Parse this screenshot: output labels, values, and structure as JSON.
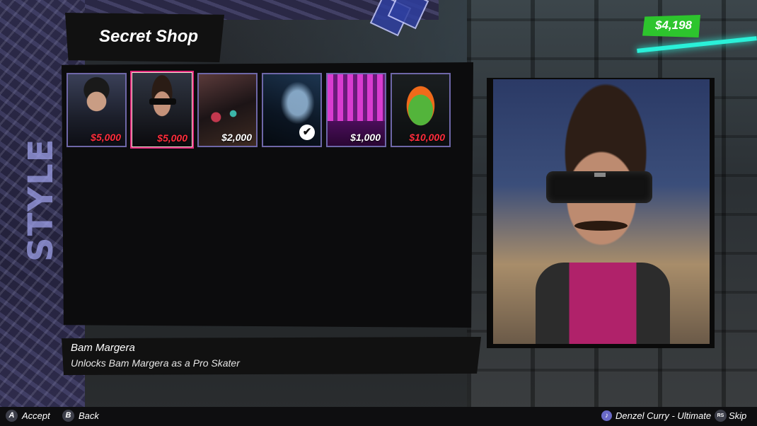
{
  "shop": {
    "title": "Secret Shop"
  },
  "wallet": {
    "balance": "$4,198",
    "color": "#2dc52d"
  },
  "items": [
    {
      "name": "pro-skater-helmet",
      "price": "$5,000",
      "price_color": "red",
      "owned": false
    },
    {
      "name": "pro-skater-bam-margera",
      "price": "$5,000",
      "price_color": "red",
      "owned": false,
      "selected": true
    },
    {
      "name": "skatepark-level",
      "price": "$2,000",
      "price_color": "white",
      "owned": false
    },
    {
      "name": "board-item",
      "price": "",
      "price_color": "white",
      "owned": true
    },
    {
      "name": "neon-level",
      "price": "$1,000",
      "price_color": "white",
      "owned": false
    },
    {
      "name": "ninja-turtle-skater",
      "price": "$10,000",
      "price_color": "red",
      "owned": false
    }
  ],
  "selected_item": {
    "name": "Bam Margera",
    "description": "Unlocks Bam Margera as a Pro Skater"
  },
  "controls": {
    "accept_key": "A",
    "accept_label": "Accept",
    "back_key": "B",
    "back_label": "Back",
    "now_playing": "Denzel Curry - Ultimate",
    "skip_key": "RS",
    "skip_label": "Skip"
  }
}
